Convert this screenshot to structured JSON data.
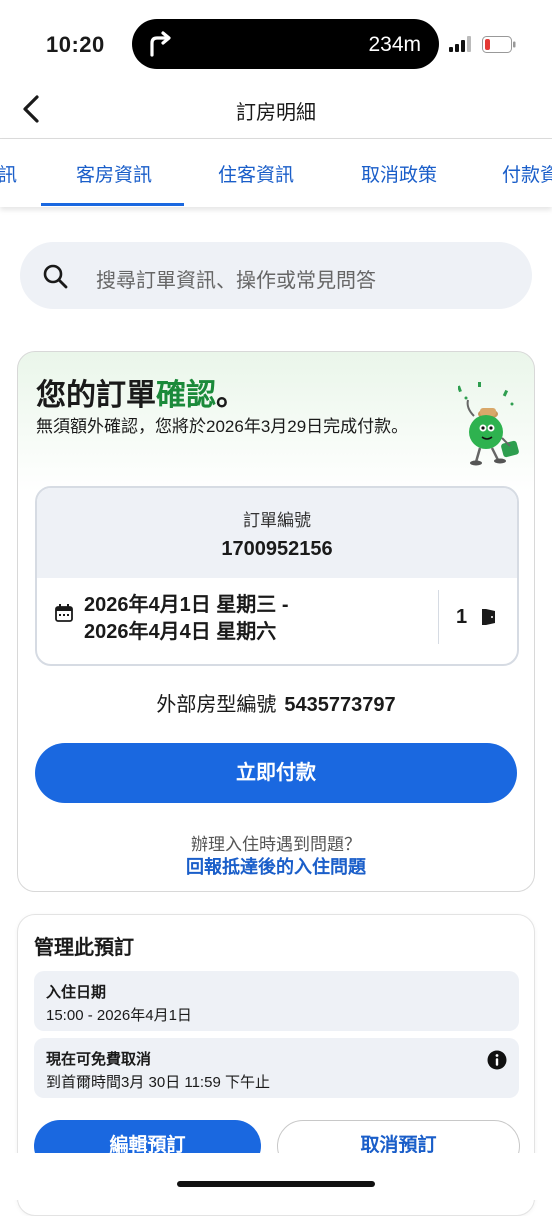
{
  "status_bar": {
    "time": "10:20",
    "nav_distance": "234m"
  },
  "header": {
    "title": "訂房明細"
  },
  "tabs": [
    {
      "label": "訊"
    },
    {
      "label": "客房資訊",
      "active": true
    },
    {
      "label": "住客資訊"
    },
    {
      "label": "取消政策"
    },
    {
      "label": "付款資"
    }
  ],
  "search": {
    "placeholder": "搜尋訂單資訊、操作或常見問答"
  },
  "confirmation": {
    "title_prefix": "您的訂單",
    "title_highlight": "確認",
    "title_suffix": "。",
    "subtitle": "無須額外確認，您將於2026年3月29日完成付款。",
    "order_number_label": "訂單編號",
    "order_number": "1700952156",
    "date_line1": "2026年4月1日 星期三 -",
    "date_line2": "2026年4月4日 星期六",
    "rooms": "1",
    "external_label": "外部房型編號",
    "external_value": "5435773797",
    "pay_button": "立即付款",
    "issue_question": "辦理入住時遇到問題？",
    "issue_link": "回報抵達後的入住問題"
  },
  "manage": {
    "title": "管理此預訂",
    "checkin_title": "入住日期",
    "checkin_value": "15:00 - 2026年4月1日",
    "cancel_title": "現在可免費取消",
    "cancel_value": "到首爾時間3月 30日 11:59 下午止",
    "edit_button": "編輯預訂",
    "cancel_button": "取消預訂"
  },
  "colors": {
    "accent_blue": "#1a68e0",
    "confirm_green": "#1b8a3a",
    "tab_text": "#1a5ec9"
  }
}
